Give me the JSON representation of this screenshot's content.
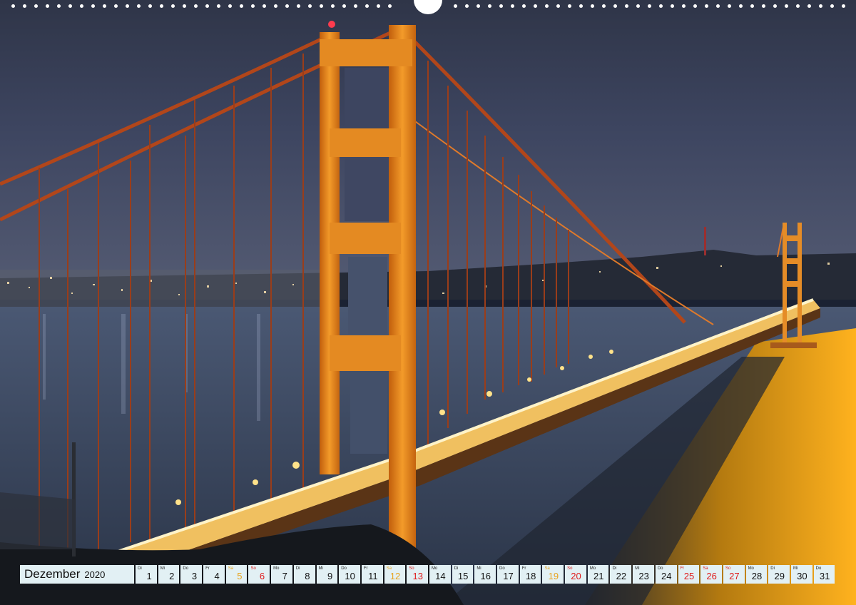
{
  "photo": {
    "subject-icon": "golden-gate-bridge-night",
    "colors": {
      "sky": "#3a4157",
      "water": "#3b4a63",
      "bridge": "#e8861a",
      "lights": "#ffd27a"
    }
  },
  "calendar": {
    "month": "Dezember",
    "year": "2020",
    "days": [
      {
        "wd": "Di",
        "num": "1",
        "kind": "weekday"
      },
      {
        "wd": "Mi",
        "num": "2",
        "kind": "weekday"
      },
      {
        "wd": "Do",
        "num": "3",
        "kind": "weekday"
      },
      {
        "wd": "Fr",
        "num": "4",
        "kind": "weekday"
      },
      {
        "wd": "Sa",
        "num": "5",
        "kind": "sat"
      },
      {
        "wd": "So",
        "num": "6",
        "kind": "sun"
      },
      {
        "wd": "Mo",
        "num": "7",
        "kind": "weekday"
      },
      {
        "wd": "Di",
        "num": "8",
        "kind": "weekday"
      },
      {
        "wd": "Mi",
        "num": "9",
        "kind": "weekday"
      },
      {
        "wd": "Do",
        "num": "10",
        "kind": "weekday"
      },
      {
        "wd": "Fr",
        "num": "11",
        "kind": "weekday"
      },
      {
        "wd": "Sa",
        "num": "12",
        "kind": "sat"
      },
      {
        "wd": "So",
        "num": "13",
        "kind": "sun"
      },
      {
        "wd": "Mo",
        "num": "14",
        "kind": "weekday"
      },
      {
        "wd": "Di",
        "num": "15",
        "kind": "weekday"
      },
      {
        "wd": "Mi",
        "num": "16",
        "kind": "weekday"
      },
      {
        "wd": "Do",
        "num": "17",
        "kind": "weekday"
      },
      {
        "wd": "Fr",
        "num": "18",
        "kind": "weekday"
      },
      {
        "wd": "Sa",
        "num": "19",
        "kind": "sat"
      },
      {
        "wd": "So",
        "num": "20",
        "kind": "sun"
      },
      {
        "wd": "Mo",
        "num": "21",
        "kind": "weekday"
      },
      {
        "wd": "Di",
        "num": "22",
        "kind": "weekday"
      },
      {
        "wd": "Mi",
        "num": "23",
        "kind": "weekday"
      },
      {
        "wd": "Do",
        "num": "24",
        "kind": "weekday"
      },
      {
        "wd": "Fr",
        "num": "25",
        "kind": "holiday"
      },
      {
        "wd": "Sa",
        "num": "26",
        "kind": "holiday"
      },
      {
        "wd": "So",
        "num": "27",
        "kind": "sun"
      },
      {
        "wd": "Mo",
        "num": "28",
        "kind": "weekday"
      },
      {
        "wd": "Di",
        "num": "29",
        "kind": "weekday"
      },
      {
        "wd": "Mi",
        "num": "30",
        "kind": "weekday"
      },
      {
        "wd": "Do",
        "num": "31",
        "kind": "weekday"
      }
    ],
    "colors": {
      "cell_bg": "#e2f0f4",
      "saturday": "#e8a31e",
      "sunday_holiday": "#e01b1b"
    }
  }
}
